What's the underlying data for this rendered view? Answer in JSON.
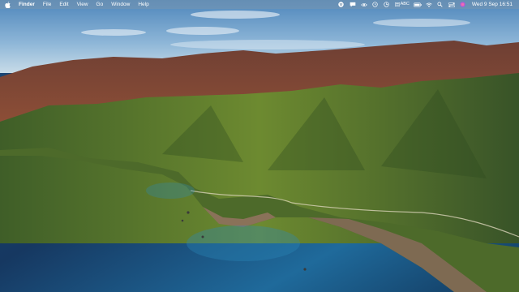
{
  "menubar": {
    "app_name": "Finder",
    "menus": [
      "File",
      "Edit",
      "View",
      "Go",
      "Window",
      "Help"
    ],
    "status_icons": [
      "spotify-icon",
      "message-bubble-icon",
      "eye-icon",
      "time-machine-icon",
      "history-icon"
    ],
    "keyboard": "ABC",
    "battery": "battery-icon",
    "wifi": "wifi-icon",
    "clock": "Wed 9 Sep  16:51"
  },
  "colors": {
    "sky": "#5f93c3",
    "ocean_deep": "#173a63",
    "ocean_shallow": "#1f6fa1",
    "hills_green": "#5d7a2b",
    "hills_red": "#8a4a33"
  }
}
